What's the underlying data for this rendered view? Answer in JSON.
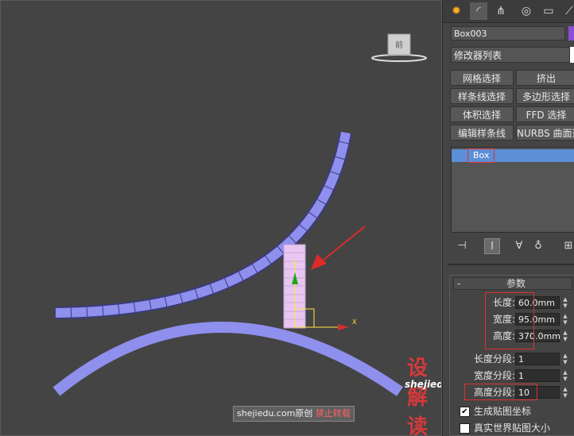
{
  "viewport": {
    "viewcube_label": "前",
    "watermark": {
      "site": "shejiedu.com",
      "original": "原创",
      "forbid": "禁止转载"
    },
    "logo_text": "设解读",
    "logo_url": "shejiedu.com",
    "gizmo_axis_x": "X",
    "gizmo_axis_y": "Y"
  },
  "panel": {
    "tabs": [
      "create-icon",
      "modify-icon",
      "hierarchy-icon",
      "motion-icon",
      "display-icon",
      "utilities-icon"
    ],
    "object_name": "Box003",
    "object_color": "#8a4fd8",
    "modifier_list": "修改器列表",
    "modifier_buttons": [
      [
        "网格选择",
        "挤出"
      ],
      [
        "样条线选择",
        "多边形选择"
      ],
      [
        "体积选择",
        "FFD 选择"
      ],
      [
        "编辑样条线",
        "NURBS 曲面选择"
      ]
    ],
    "stack_items": [
      "Box"
    ],
    "rollout_title": "参数",
    "rollout_toggle": "-",
    "params": [
      {
        "label": "长度:",
        "value": "60.0mm"
      },
      {
        "label": "宽度:",
        "value": "95.0mm"
      },
      {
        "label": "高度:",
        "value": "370.0mm"
      },
      {
        "label": "长度分段:",
        "value": "1"
      },
      {
        "label": "宽度分段:",
        "value": "1"
      },
      {
        "label": "高度分段:",
        "value": "10"
      }
    ],
    "checkboxes": [
      {
        "label": "生成贴图坐标",
        "checked": true,
        "mark": "✔"
      },
      {
        "label": "真实世界贴图大小",
        "checked": false,
        "mark": ""
      }
    ]
  }
}
